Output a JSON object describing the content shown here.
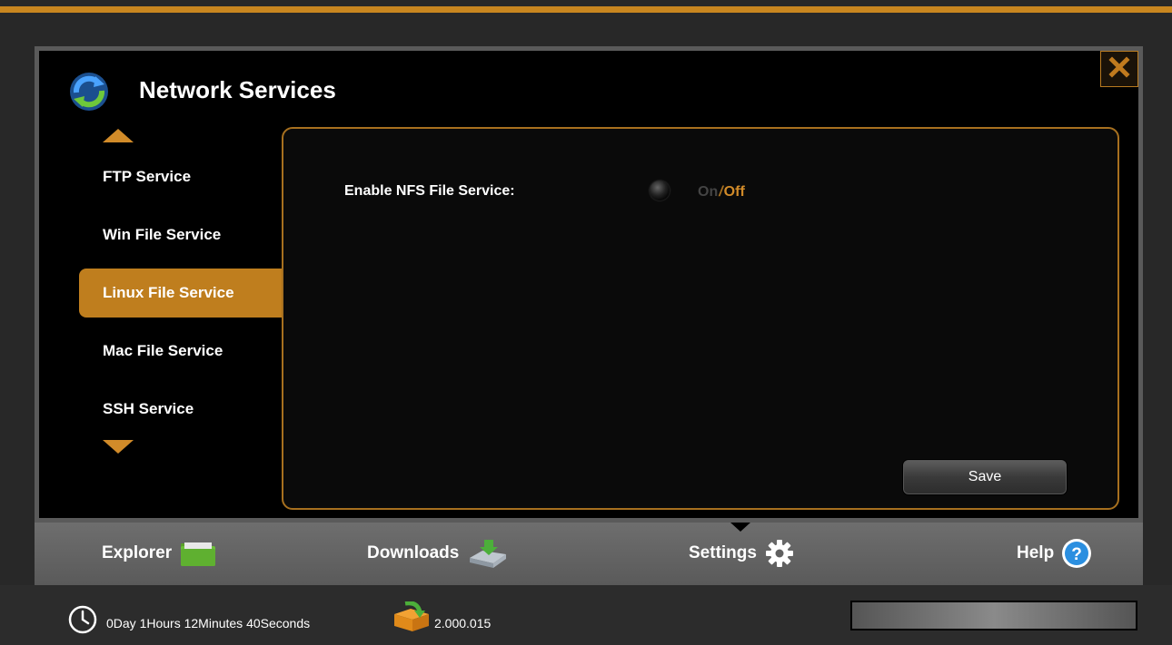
{
  "colors": {
    "accent": "#c8861f",
    "background": "#282828",
    "dialog_bg": "#000000"
  },
  "dialog": {
    "title": "Network Services",
    "title_icon": "refresh-sync-icon",
    "close_icon": "close-x-icon"
  },
  "sidebar": {
    "items": [
      {
        "label": "FTP Service",
        "active": false
      },
      {
        "label": "Win File Service",
        "active": false
      },
      {
        "label": "Linux File Service",
        "active": true
      },
      {
        "label": "Mac File Service",
        "active": false
      },
      {
        "label": "SSH Service",
        "active": false
      }
    ]
  },
  "panel": {
    "nfs_label": "Enable NFS File Service:",
    "toggle_on": "On",
    "toggle_separator": "/",
    "toggle_off": "Off",
    "toggle_state": "Off",
    "save_label": "Save"
  },
  "navbar": {
    "items": [
      {
        "label": "Explorer",
        "icon": "folder-icon"
      },
      {
        "label": "Downloads",
        "icon": "download-drive-icon"
      },
      {
        "label": "Settings",
        "icon": "gear-icon",
        "active": true
      },
      {
        "label": "Help",
        "icon": "help-question-icon"
      }
    ]
  },
  "status": {
    "uptime": "0Day 1Hours 12Minutes 40Seconds",
    "version": "2.000.015",
    "progress_fraction": 1.0
  }
}
